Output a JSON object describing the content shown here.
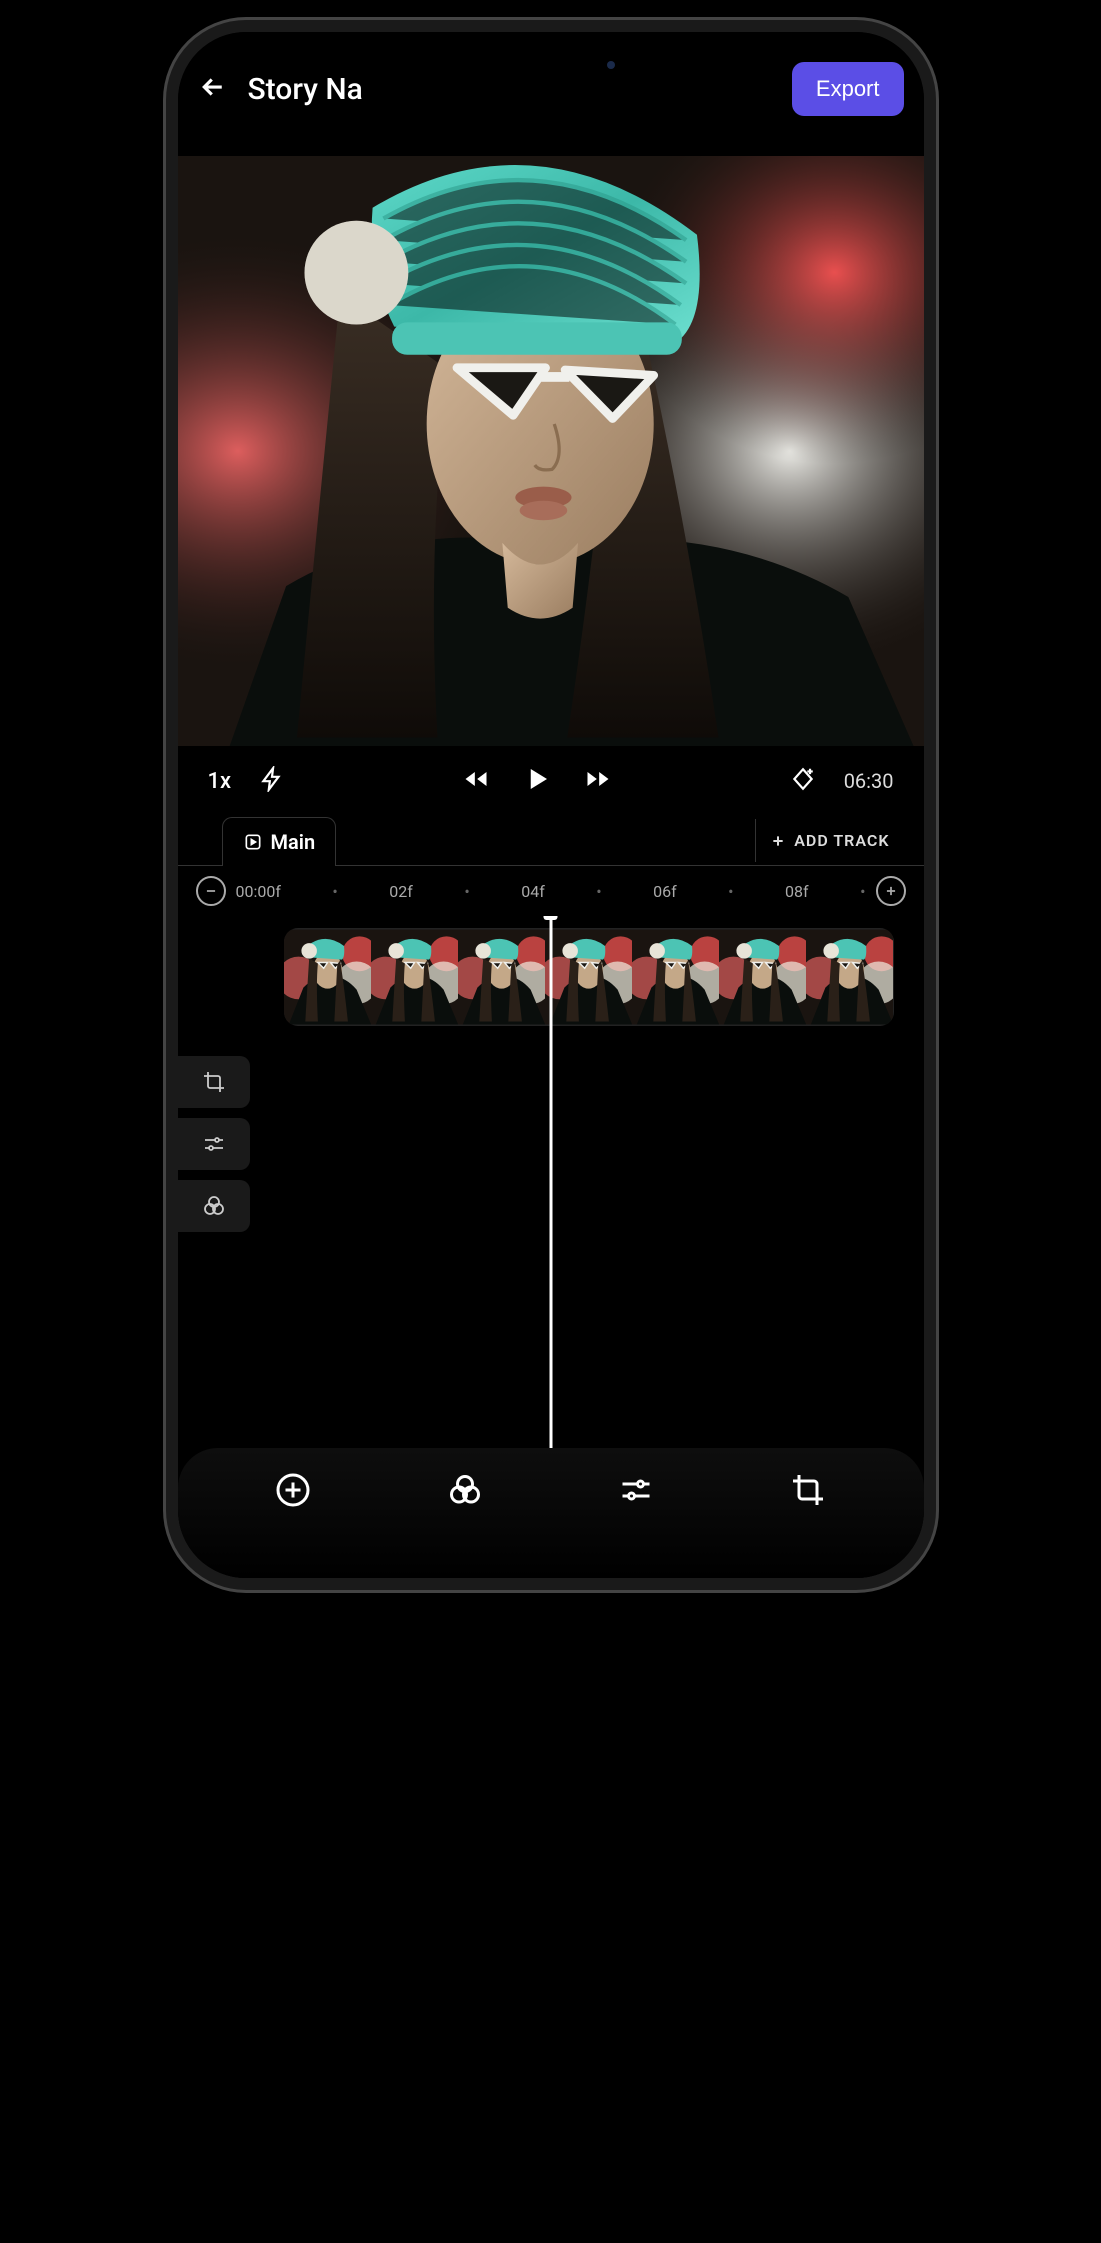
{
  "header": {
    "title": "Story Na",
    "export_label": "Export"
  },
  "playback": {
    "speed": "1x",
    "time": "06:30"
  },
  "tabs": {
    "main_label": "Main",
    "add_track_label": "ADD TRACK"
  },
  "ruler": {
    "marks": [
      "00:00f",
      "02f",
      "04f",
      "06f",
      "08f"
    ]
  },
  "icons": {
    "back": "back-arrow",
    "lightning": "lightning",
    "rewind": "rewind",
    "play": "play",
    "forward": "forward",
    "keyframe": "keyframe-add",
    "zoom_out": "minus",
    "zoom_in": "plus",
    "crop": "crop",
    "sliders": "sliders",
    "filters": "filters",
    "add": "add-circle"
  }
}
